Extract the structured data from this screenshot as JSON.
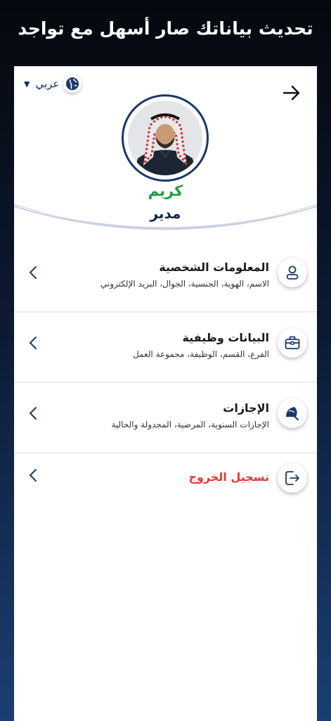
{
  "promo": {
    "title": "تحديث بياناتك صار أسهل مع تواجد"
  },
  "header": {
    "language_label": "عربي",
    "user_name": "كريم",
    "user_role": "مدير"
  },
  "menu": [
    {
      "title": "المعلومات الشخصية",
      "subtitle": "الاسم، الهوية، الجنسية، الجوال، البريد الإلكتروني",
      "icon": "person-icon"
    },
    {
      "title": "البيانات وظيفية",
      "subtitle": "الفرع، القسم، الوظيفة، مجموعة العمل",
      "icon": "briefcase-icon"
    },
    {
      "title": "الإجازات",
      "subtitle": "الإجازات السنوية، المرضية، المجدولة والحالية",
      "icon": "umbrella-icon"
    },
    {
      "title": "تسجيل الخروج",
      "icon": "logout-icon"
    }
  ],
  "colors": {
    "accent": "#1a3768",
    "name_green": "#1e9e43",
    "logout_red": "#e53935"
  }
}
